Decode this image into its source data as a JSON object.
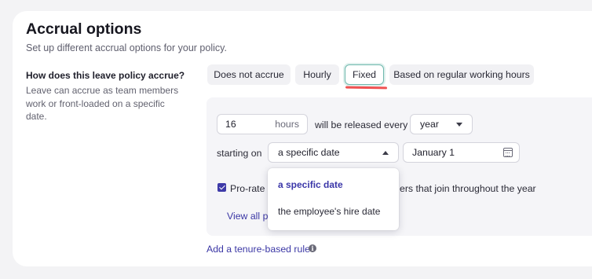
{
  "header": {
    "title": "Accrual options",
    "subtitle": "Set up different accrual options for your policy."
  },
  "question": {
    "title": "How does this leave policy accrue?",
    "description": "Leave can accrue as team members work or front-loaded on a specific date."
  },
  "accrual_types": {
    "options": [
      "Does not accrue",
      "Hourly",
      "Fixed",
      "Based on regular working hours"
    ],
    "selected": "Fixed"
  },
  "release": {
    "amount_value": "16",
    "amount_unit": "hours",
    "middle_text": "will be released every",
    "period_value": "year",
    "starting_label": "starting on",
    "start_type_value": "a specific date",
    "start_date_value": "January 1"
  },
  "start_type_dropdown": {
    "options": [
      "a specific date",
      "the employee's hire date"
    ],
    "selected": "a specific date"
  },
  "prorate": {
    "label_start": "Pro-rate f",
    "label_end": "ers that join throughout the year",
    "checked": true
  },
  "links": {
    "view_all_partial": "View all p",
    "add_tenure_rule": "Add a tenure-based rule"
  },
  "icons": {
    "calendar": "calendar-icon",
    "info": "info-icon",
    "check": "check-icon"
  },
  "colors": {
    "accent": "#3b37a5",
    "selected_border": "#6fb8ad",
    "annotation_underline": "#f05252"
  }
}
